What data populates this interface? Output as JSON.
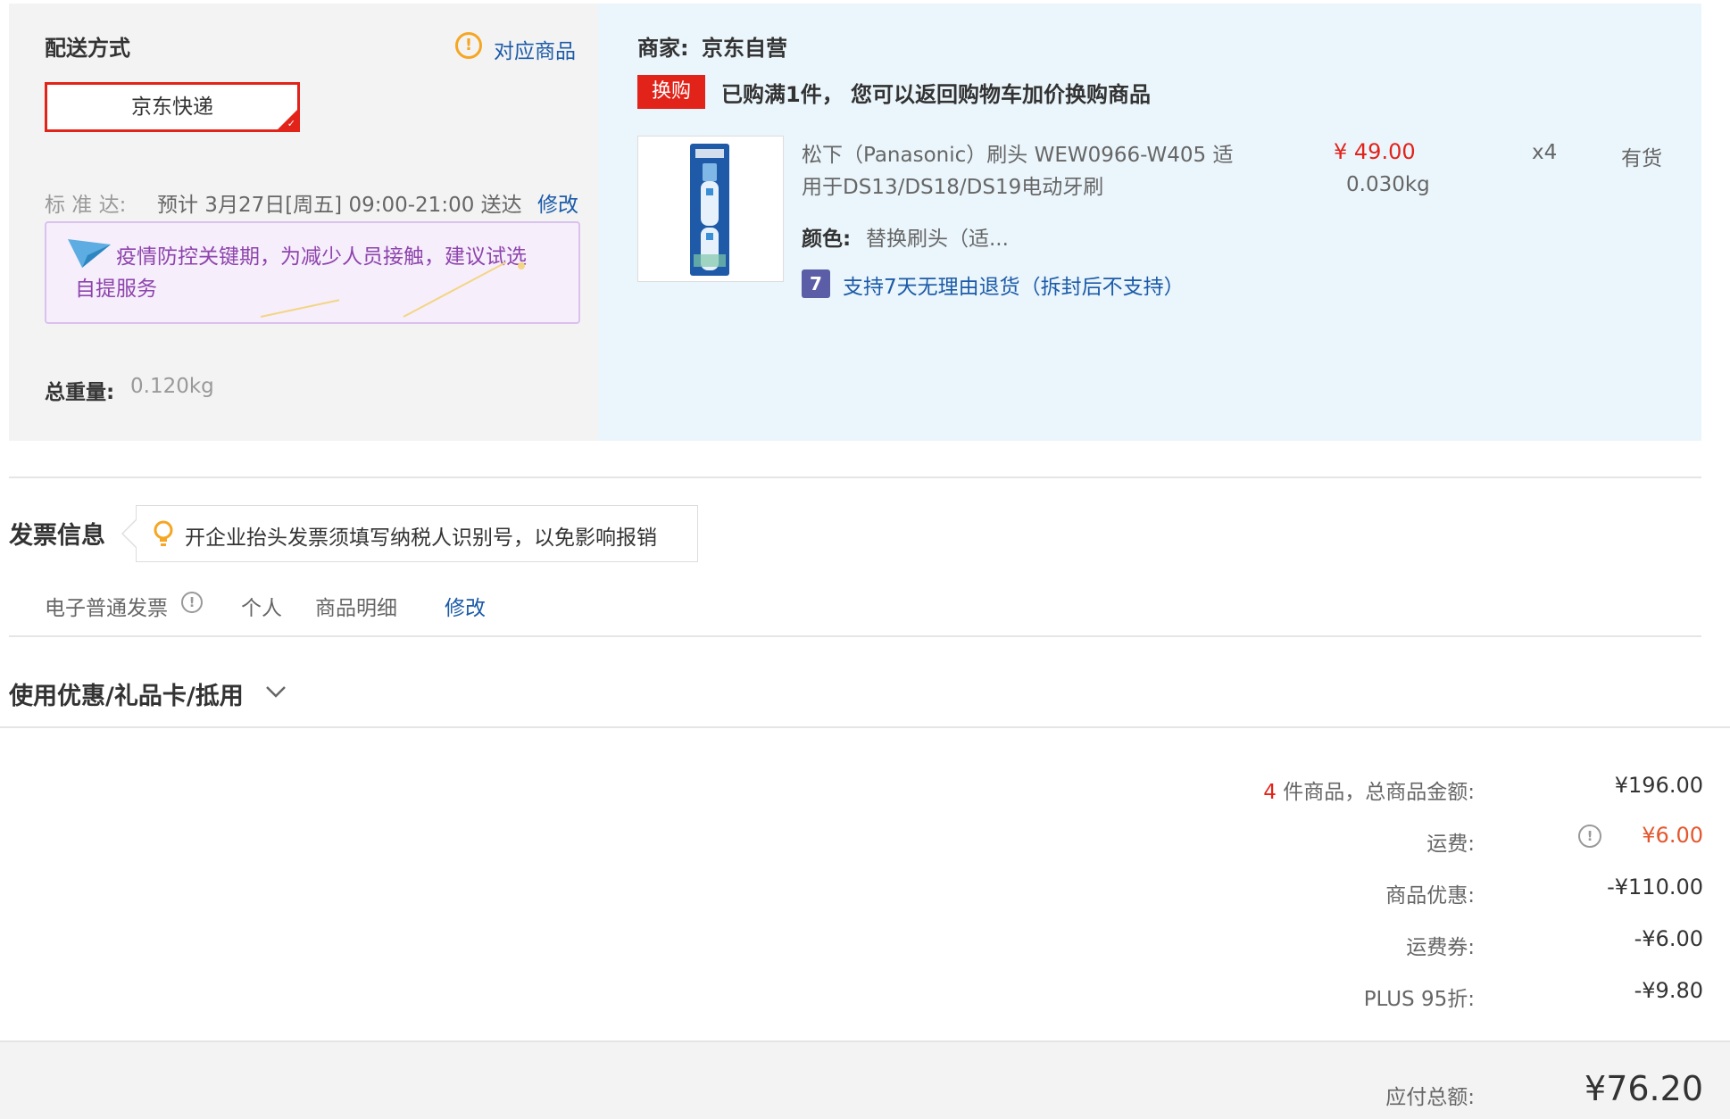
{
  "shipping": {
    "title": "配送方式",
    "match_link": "对应商品",
    "method": "京东快递",
    "standard_label": "标 准 达:",
    "eta": "预计 3月27日[周五] 09:00-21:00 送达",
    "edit": "修改",
    "notice_line1": "疫情防控关键期，为减少人员接触，建议试选",
    "notice_line2": "自提服务",
    "weight_label": "总重量:",
    "weight_value": "0.120kg"
  },
  "vendor": {
    "label": "商家:",
    "name": "京东自营",
    "tag": "换购",
    "promo": "已购满1件， 您可以返回购物车加价换购商品"
  },
  "product": {
    "name_line1": "松下（Panasonic）刷头 WEW0966-W405 适",
    "name_line2": "用于DS13/DS18/DS19电动牙刷",
    "price": "¥ 49.00",
    "weight": "0.030kg",
    "quantity": "x4",
    "stock": "有货",
    "color_label": "颜色:",
    "color_value": "替换刷头（适...",
    "return_badge": "7",
    "return_policy": "支持7天无理由退货（拆封后不支持）"
  },
  "invoice": {
    "title": "发票信息",
    "tip": "开企业抬头发票须填写纳税人识别号，以免影响报销",
    "type": "电子普通发票",
    "title_type": "个人",
    "content": "商品明细",
    "edit": "修改"
  },
  "discount": {
    "title": "使用优惠/礼品卡/抵用"
  },
  "summary": {
    "item_count": "4",
    "items_label": "件商品，总商品金额:",
    "items_total": "¥196.00",
    "shipping_label": "运费:",
    "shipping_value": "¥6.00",
    "product_discount_label": "商品优惠:",
    "product_discount_value": "-¥110.00",
    "shipping_coupon_label": "运费券:",
    "shipping_coupon_value": "-¥6.00",
    "plus_label": "PLUS 95折:",
    "plus_value": "-¥9.80",
    "payable_label": "应付总额:",
    "payable_value": "¥76.20"
  },
  "colors": {
    "accent_red": "#e2231a",
    "link_blue": "#1c5ba8",
    "orange": "#e4393c",
    "notice_purple": "#8e44ad"
  }
}
